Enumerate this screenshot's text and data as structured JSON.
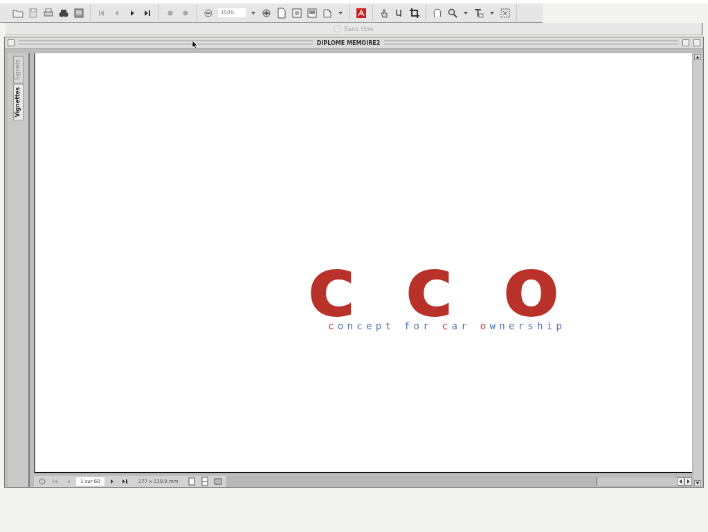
{
  "toolbar": {
    "zoom_value": "150%"
  },
  "document_list": {
    "title": "Sans titre"
  },
  "document_window": {
    "title": "DIPLOME MEMOIRE2",
    "side_tabs": [
      {
        "label": "Vignettes",
        "selected": true
      },
      {
        "label": "Signets",
        "selected": false
      }
    ],
    "page": {
      "logo": "cco",
      "tagline": [
        {
          "text": "c",
          "accent": true
        },
        {
          "text": "oncept for ",
          "accent": false
        },
        {
          "text": "c",
          "accent": true
        },
        {
          "text": "ar ",
          "accent": false
        },
        {
          "text": "o",
          "accent": true
        },
        {
          "text": "wnership",
          "accent": false
        }
      ]
    },
    "status_bar": {
      "page_field": "1 sur 60",
      "page_size": "277 x 139,9 mm"
    }
  }
}
